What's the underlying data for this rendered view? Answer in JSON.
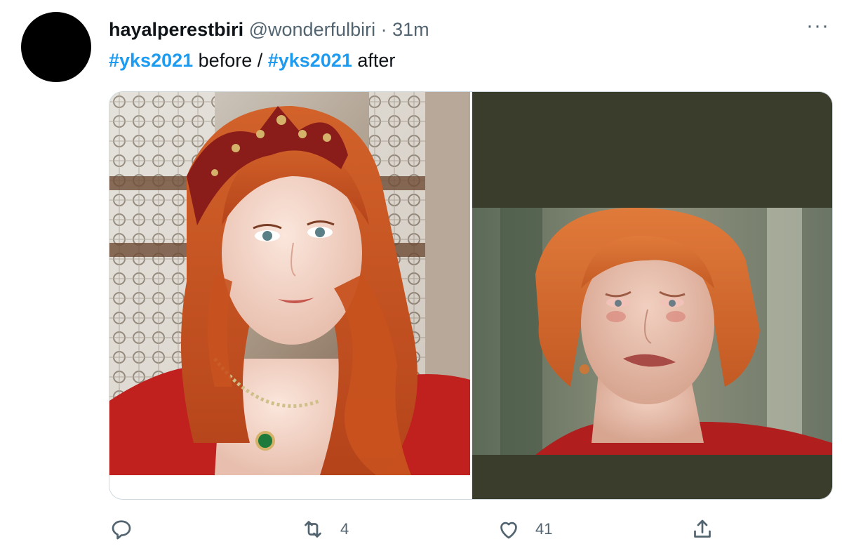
{
  "user": {
    "display_name": "hayalperestbiri",
    "handle": "@wonderfulbiri",
    "separator": "·",
    "time": "31m"
  },
  "tweet": {
    "hashtag_1": "#yks2021",
    "word_1": "before /",
    "hashtag_2": "#yks2021",
    "word_2": "after"
  },
  "menu": {
    "more_icon": "more-horizontal-icon",
    "more_label": "···"
  },
  "media": {
    "left_image": "smiling red-haired woman wearing a jeweled crown",
    "right_image": "crying red-haired woman"
  },
  "actions": {
    "reply_icon": "reply-icon",
    "retweet_icon": "retweet-icon",
    "retweet_count": "4",
    "like_icon": "heart-icon",
    "like_count": "41",
    "share_icon": "share-icon"
  },
  "colors": {
    "accent": "#1d9bf0",
    "secondary_text": "#536471",
    "right_backdrop": "#3a3d2c"
  }
}
